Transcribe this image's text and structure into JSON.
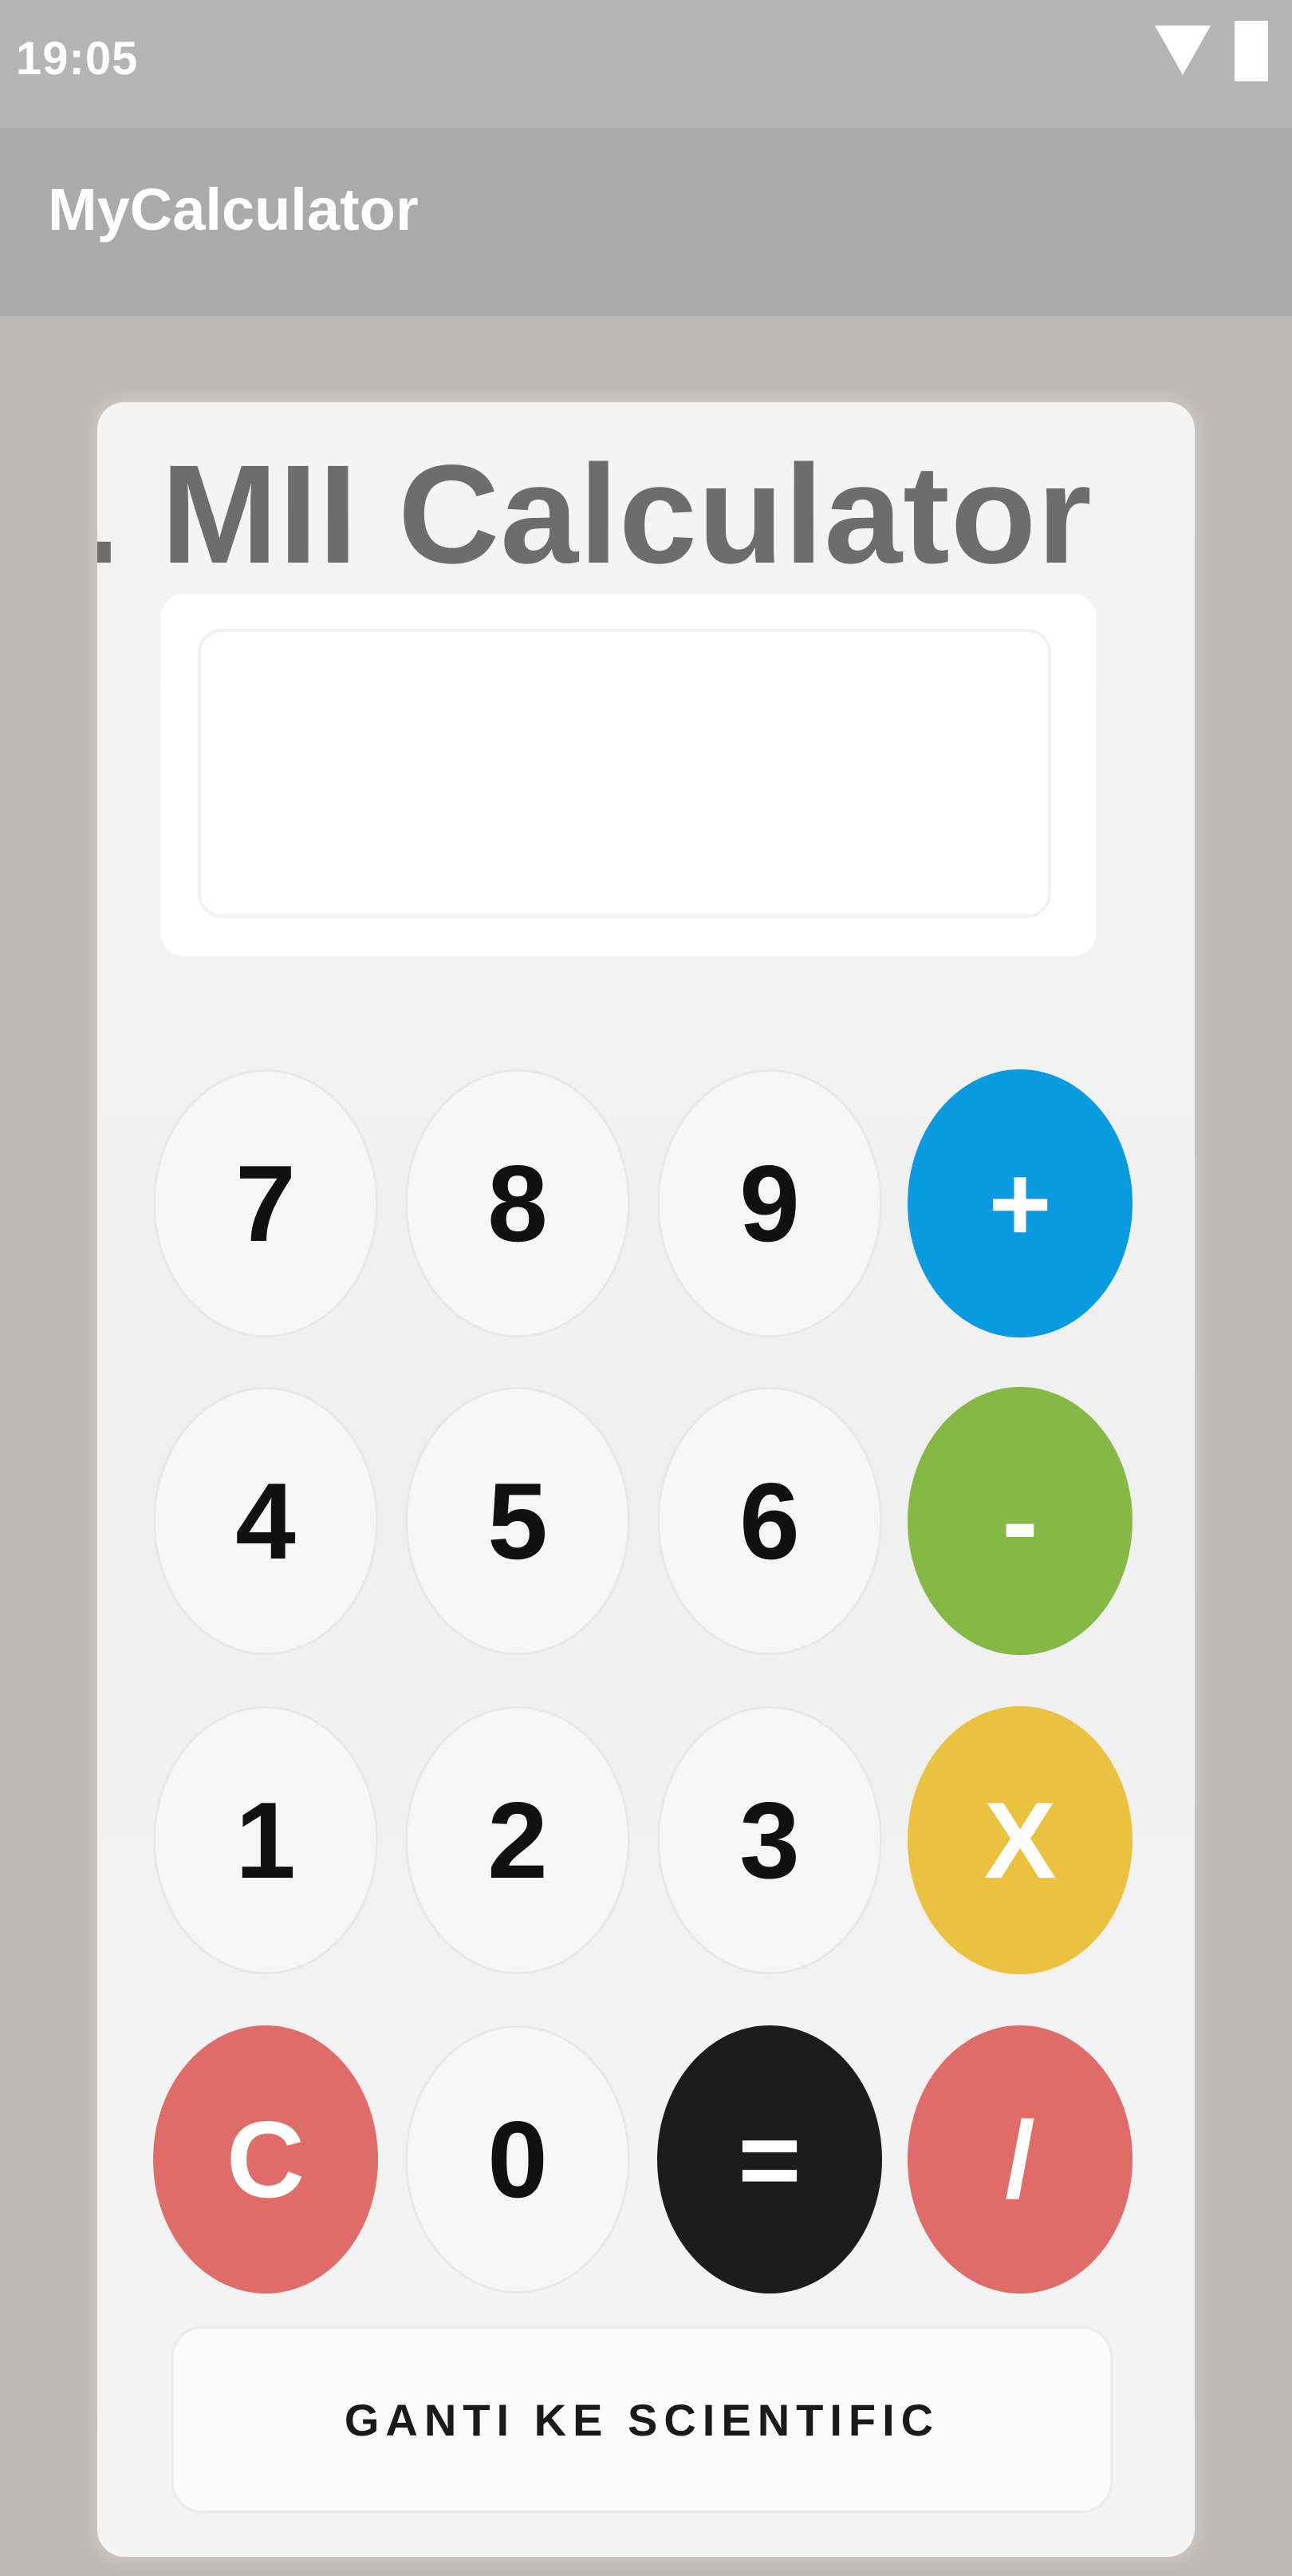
{
  "status_bar": {
    "time": "19:05",
    "wifi_icon": "wifi-icon",
    "battery_icon": "battery-icon"
  },
  "app_bar": {
    "title": "MyCalculator"
  },
  "calculator": {
    "heading": ". MII Calculator",
    "display_value": "",
    "keys": {
      "seven": "7",
      "eight": "8",
      "nine": "9",
      "plus": "+",
      "four": "4",
      "five": "5",
      "six": "6",
      "minus": "-",
      "one": "1",
      "two": "2",
      "three": "3",
      "multiply": "X",
      "clear": "C",
      "zero": "0",
      "equals": "=",
      "divide": "/"
    },
    "toggle_label": "GANTI KE SCIENTIFIC"
  },
  "colors": {
    "plus": "#0a9ae0",
    "minus": "#85b845",
    "multiply": "#ebc140",
    "clear": "#e06c6a",
    "equals": "#1c1c1c",
    "divide": "#e06c6a"
  }
}
